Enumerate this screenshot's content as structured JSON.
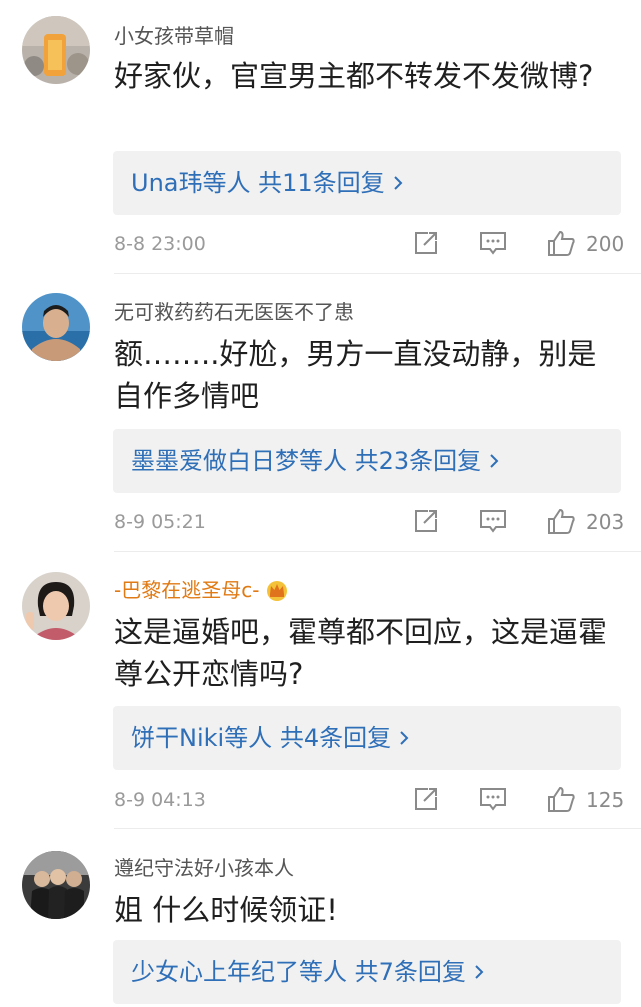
{
  "comments": [
    {
      "user": "小女孩带草帽",
      "text": "好家伙，官宣男主都不转发不发微博?",
      "reply": "Una玮等人 共11条回复",
      "date": "8-8 23:00",
      "likes": "200"
    },
    {
      "user": "无可救药药石无医医不了患",
      "text": "额……..好尬，男方一直没动静，别是自作多情吧",
      "reply": "墨墨爱做白日梦等人 共23条回复",
      "date": "8-9 05:21",
      "likes": "203"
    },
    {
      "user": "-巴黎在逃圣母c-",
      "text": "这是逼婚吧，霍尊都不回应，这是逼霍尊公开恋情吗?",
      "reply": "饼干Niki等人 共4条回复",
      "date": "8-9 04:13",
      "likes": "125"
    },
    {
      "user": "遵纪守法好小孩本人",
      "text": "姐 什么时候领证!",
      "reply": "少女心上年纪了等人 共7条回复"
    }
  ],
  "colors": {
    "link": "#2f6fb8",
    "vip_name": "#e07a14",
    "icon": "#8a8a8a"
  },
  "icons": {
    "share": "share-icon",
    "comment": "comment-icon",
    "like": "thumbs-up-icon",
    "crown": "crown-icon"
  }
}
